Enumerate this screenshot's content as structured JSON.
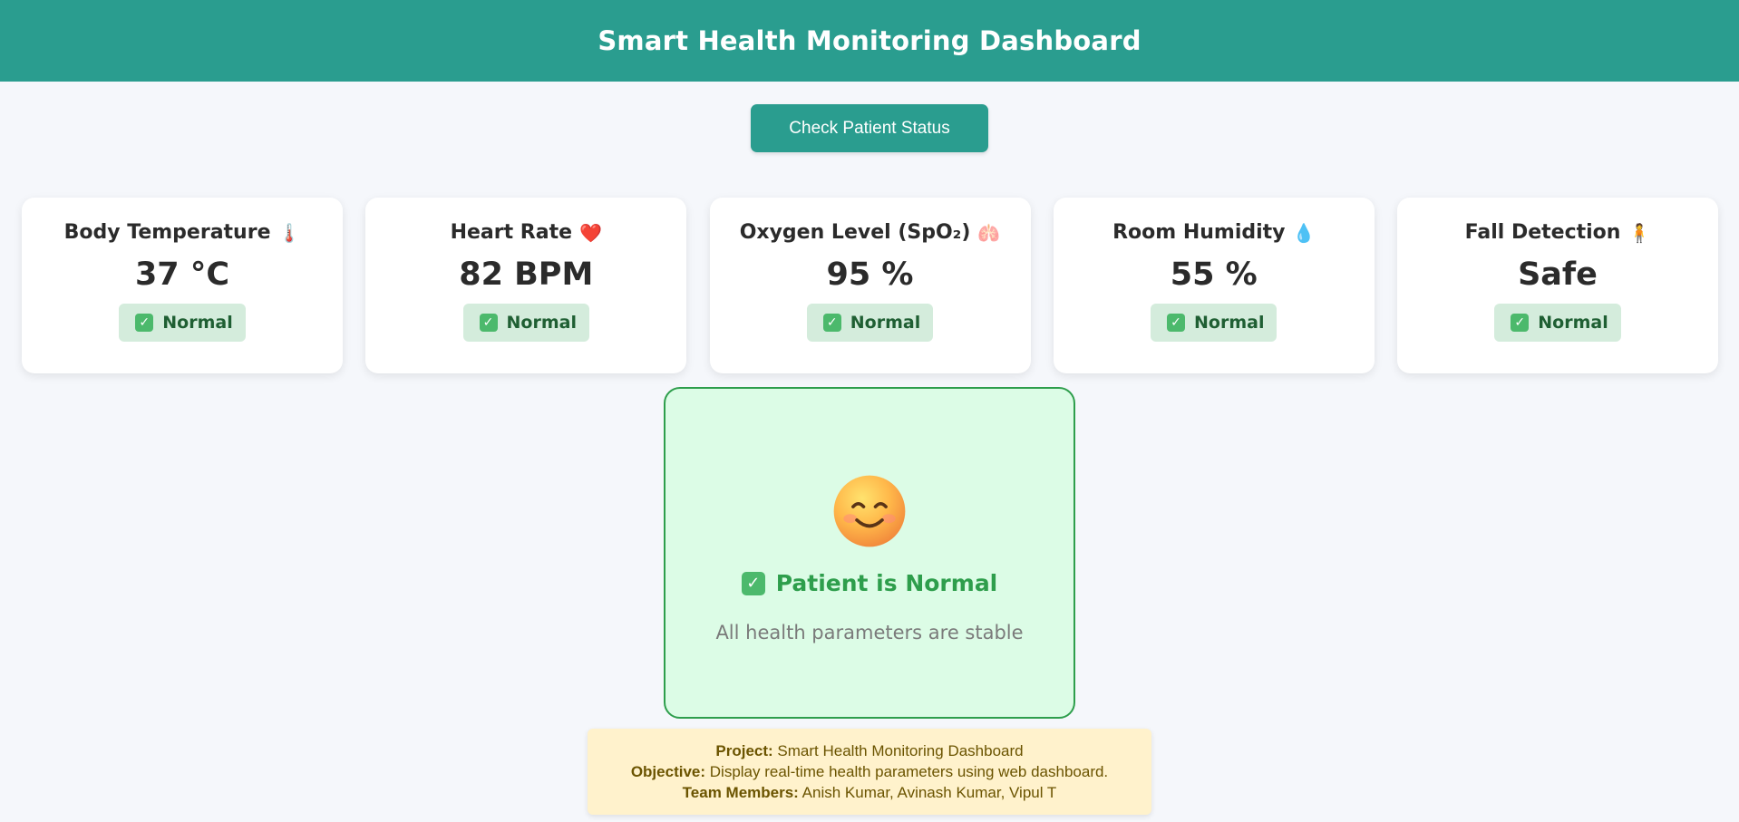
{
  "header": {
    "title": "Smart Health Monitoring Dashboard"
  },
  "actions": {
    "check_button_label": "Check Patient Status"
  },
  "colors": {
    "header_bg": "#2a9d8f",
    "button_bg": "#2a9d8f",
    "badge_bg": "#d4ecdc",
    "badge_text": "#1f5f33",
    "status_bg": "#dcfce6",
    "status_border": "#2e9e4c",
    "info_bg": "#fff2cc"
  },
  "cards": [
    {
      "title": "Body Temperature",
      "icon": "thermometer-icon",
      "emoji": "🌡️",
      "value": "37 °C",
      "status": "Normal"
    },
    {
      "title": "Heart Rate",
      "icon": "heart-icon",
      "emoji": "❤️",
      "value": "82 BPM",
      "status": "Normal"
    },
    {
      "title": "Oxygen Level (SpO₂)",
      "icon": "lungs-icon",
      "emoji": "🫁",
      "value": "95 %",
      "status": "Normal"
    },
    {
      "title": "Room Humidity",
      "icon": "droplet-icon",
      "emoji": "💧",
      "value": "55 %",
      "status": "Normal"
    },
    {
      "title": "Fall Detection",
      "icon": "standing-person-icon",
      "emoji": "🧍",
      "value": "Safe",
      "status": "Normal"
    }
  ],
  "status_panel": {
    "icon": "smiling-face-icon",
    "title": "Patient is Normal",
    "subtitle": "All health parameters are stable"
  },
  "info": {
    "project_label": "Project:",
    "project_value": "Smart Health Monitoring Dashboard",
    "objective_label": "Objective:",
    "objective_value": "Display real-time health parameters using web dashboard.",
    "team_label": "Team Members:",
    "team_value": "Anish Kumar, Avinash Kumar, Vipul T"
  }
}
